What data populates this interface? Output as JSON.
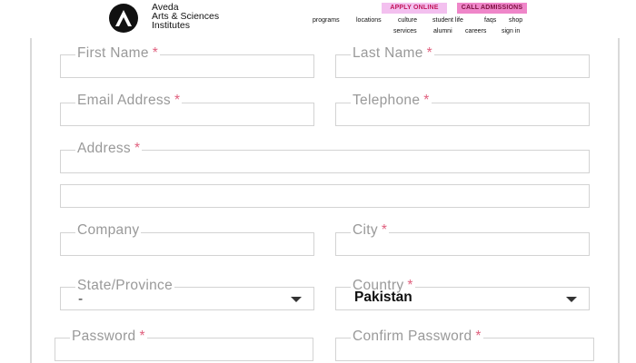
{
  "header": {
    "brand_line1": "Aveda",
    "brand_line2": "Arts & Sciences",
    "brand_line3": "Institutes",
    "apply_label": "APPLY ONLINE",
    "call_label": "CALL ADMISSIONS",
    "nav_row1": [
      "programs",
      "locations",
      "culture",
      "student life",
      "faqs",
      "shop"
    ],
    "nav_row2": [
      "services",
      "alumni",
      "careers",
      "sign in"
    ]
  },
  "form": {
    "first_name": "First Name",
    "last_name": "Last Name",
    "email": "Email Address",
    "telephone": "Telephone",
    "address": "Address",
    "company": "Company",
    "city": "City",
    "state": "State/Province",
    "state_value": "-",
    "country": "Country",
    "country_value": "Pakistan",
    "password": "Password",
    "confirm_password": "Confirm Password",
    "required_mark": "*"
  }
}
